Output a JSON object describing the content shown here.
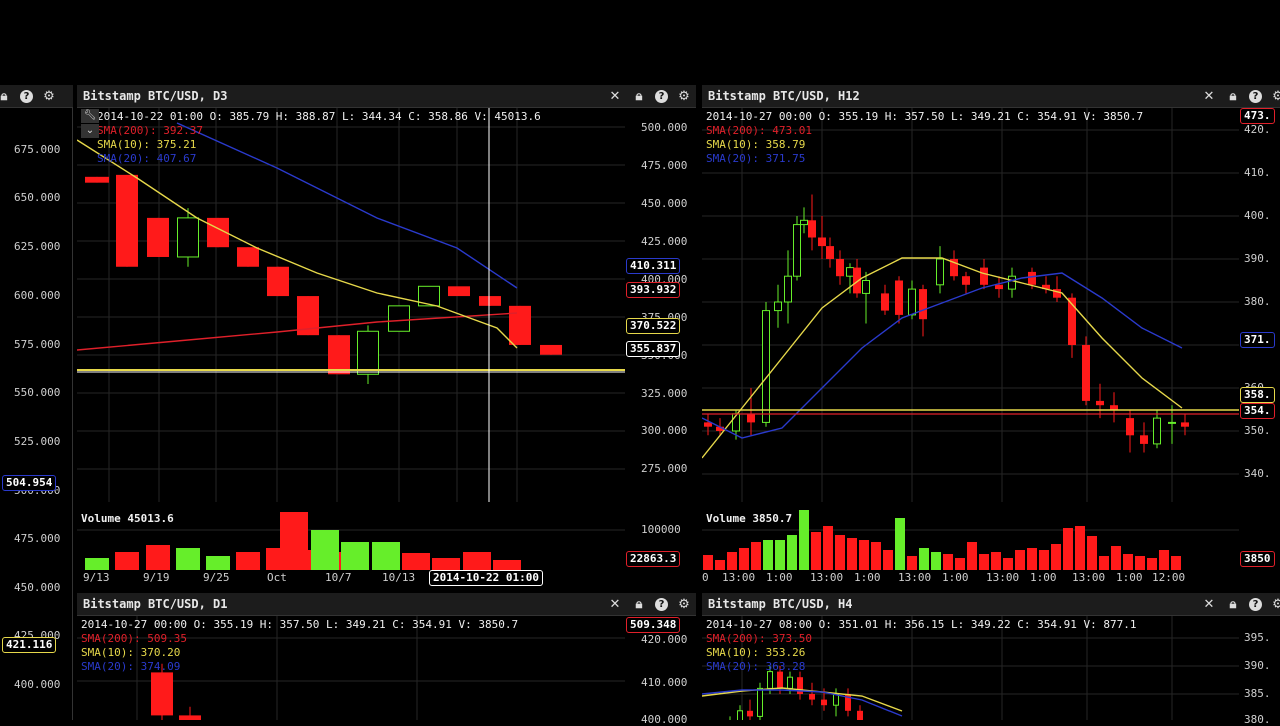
{
  "colors": {
    "bull": "#66ee2a",
    "bear": "#ff1a1a",
    "sma200": "#e0202a",
    "sma10": "#e6d84a",
    "sma20": "#2a3acc",
    "white": "#ffffff"
  },
  "left_partial": {
    "ticks": [
      "675.000",
      "650.000",
      "625.000",
      "600.000",
      "575.000",
      "550.000",
      "525.000",
      "500.000",
      "475.000",
      "450.000",
      "425.000",
      "400.000"
    ],
    "tags": [
      "504.954",
      "421.116"
    ]
  },
  "panel_d3": {
    "title": "Bitstamp BTC/USD, D3",
    "ohlcv": "2014-10-22 01:00   O: 385.79 H: 388.87 L: 344.34 C: 358.86 V: 45013.6",
    "sma200": "SMA(200): 392.37",
    "sma10": "SMA(10): 375.21",
    "sma20": "SMA(20): 407.67",
    "ticks": [
      "500.000",
      "475.000",
      "450.000",
      "425.000",
      "400.000",
      "375.000",
      "350.000",
      "325.000",
      "300.000",
      "275.000"
    ],
    "tags": [
      "410.311",
      "393.932",
      "370.522",
      "355.837"
    ],
    "volume_label": "Volume 45013.6",
    "vol_ticks": [
      "100000"
    ],
    "vol_tag": "22863.3",
    "xticks": [
      "9/13",
      "9/19",
      "9/25",
      "Oct",
      "10/7",
      "10/13"
    ],
    "cursor_time": "2014-10-22 01:00"
  },
  "panel_h12": {
    "title": "Bitstamp BTC/USD, H12",
    "ohlcv": "2014-10-27 00:00   O: 355.19 H: 357.50 L: 349.21 C: 354.91 V: 3850.7",
    "sma200": "SMA(200): 473.01",
    "sma10": "SMA(10): 358.79",
    "sma20": "SMA(20): 371.75",
    "ticks": [
      "420.",
      "410.",
      "400.",
      "390.",
      "380.",
      "370.",
      "360.",
      "350.",
      "340."
    ],
    "tags": [
      "473.",
      "371.",
      "358.",
      "354."
    ],
    "volume_label": "Volume 3850.7",
    "vol_tag": "3850",
    "xticks": [
      "0",
      "13:00",
      "1:00",
      "13:00",
      "1:00",
      "13:00",
      "1:00",
      "13:00",
      "1:00",
      "13:00",
      "1:00",
      "12:00"
    ]
  },
  "panel_d1": {
    "title": "Bitstamp BTC/USD, D1",
    "ohlcv": "2014-10-27 00:00   O: 355.19 H: 357.50 L: 349.21 C: 354.91 V: 3850.7",
    "sma200": "SMA(200): 509.35",
    "sma10": "SMA(10): 370.20",
    "sma20": "SMA(20): 374.09",
    "ticks": [
      "420.000",
      "410.000",
      "400.000"
    ],
    "tags": [
      "509.348"
    ]
  },
  "panel_h4": {
    "title": "Bitstamp BTC/USD, H4",
    "ohlcv": "2014-10-27 08:00   O: 351.01 H: 356.15 L: 349.22 C: 354.91 V: 877.1",
    "sma200": "SMA(200): 373.50",
    "sma10": "SMA(10): 353.26",
    "sma20": "SMA(20): 363.28",
    "ticks": [
      "395.",
      "390.",
      "385.",
      "380."
    ]
  },
  "icons": {
    "close": "close-icon",
    "lock": "lock-icon",
    "help": "help-icon",
    "settings": "gear-icon",
    "wrench": "wrench-icon",
    "chevron": "chevron-down-icon"
  }
}
